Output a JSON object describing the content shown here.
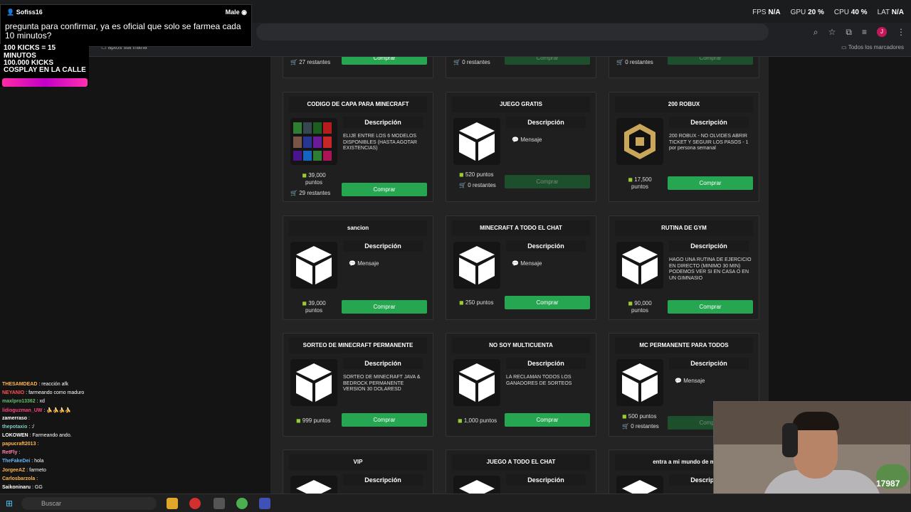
{
  "performance": {
    "fps_label": "FPS",
    "fps": "N/A",
    "gpu_label": "GPU",
    "gpu": "20 %",
    "cpu_label": "CPU",
    "cpu": "40 %",
    "lat_label": "LAT",
    "lat": "N/A"
  },
  "browser": {
    "bookmark_left": "aptos sta maria",
    "bookmark_right": "Todos los marcadores",
    "avatar": "J"
  },
  "stream_notice": {
    "user": "Sofiss16",
    "badge": "Male",
    "message": "pregunta para confirmar, ya es oficial que solo se farmea cada 10 minutos?"
  },
  "overlay": {
    "line1": "100 KICKS = 15 MINUTOS",
    "line2": "100.000 KICKS COSPLAY EN LA CALLE"
  },
  "chat": [
    {
      "user": "THESAMDEAD",
      "text": "reacción afk",
      "color": "#ffb74d"
    },
    {
      "user": "NEYANIO",
      "text": "farmeando como maduro",
      "color": "#ff5252"
    },
    {
      "user": "maxlpro13362",
      "text": "xd",
      "color": "#66bb6a"
    },
    {
      "user": "lidioguzman_UW",
      "text": "🍌🍌🍌🍌",
      "color": "#ff4081"
    },
    {
      "user": "zamerraso",
      "text": "",
      "color": "#ffffff"
    },
    {
      "user": "thepotaxio",
      "text": ":/",
      "color": "#80cbc4"
    },
    {
      "user": "LOKOWEN",
      "text": "Farmeando ando.",
      "color": "#ffffff"
    },
    {
      "user": "papucraft2013",
      "text": "",
      "color": "#ffb74d"
    },
    {
      "user": "RetFly",
      "text": "",
      "color": "#ff80ab"
    },
    {
      "user": "TheFakeDei",
      "text": "hola",
      "color": "#64b5f6"
    },
    {
      "user": "JorgeeAZ",
      "text": "farmeto",
      "color": "#ffb74d"
    },
    {
      "user": "Carlosbarzola",
      "text": "",
      "color": "#ffb74d"
    },
    {
      "user": "Saikoninaru",
      "text": "GG",
      "color": "#ffffff"
    }
  ],
  "common": {
    "buy": "Comprar",
    "desc": "Descripción",
    "msg": "Mensaje",
    "points": "puntos",
    "remaining_suffix": "restantes"
  },
  "top_row": [
    {
      "remaining": "27 restantes",
      "enabled": true
    },
    {
      "remaining": "0 restantes",
      "enabled": false
    },
    {
      "remaining": "0 restantes",
      "enabled": false
    }
  ],
  "cards": [
    {
      "title": "CODIGO DE CAPA PARA MINECRAFT",
      "desc": "ELIJE ENTRE LOS 6 MODELOS DISPONIBLES (HASTA AGOTAR EXISTENCIAS)",
      "points": "39,000",
      "remaining": "29 restantes",
      "enabled": true
    },
    {
      "title": "JUEGO GRATIS",
      "desc": "",
      "points": "520 puntos",
      "remaining": "0 restantes",
      "enabled": false
    },
    {
      "title": "200 ROBUX",
      "desc": "200 ROBUX - NO OLVIDES ABRIR TICKET Y SEGUIR LOS PASOS - 1 por persona semanal",
      "points": "17,500",
      "remaining": "",
      "enabled": true
    },
    {
      "title": "sancion",
      "desc": "",
      "points": "39,000",
      "remaining": "",
      "enabled": true
    },
    {
      "title": "MINECRAFT A TODO EL CHAT",
      "desc": "",
      "points": "250 puntos",
      "remaining": "",
      "enabled": true
    },
    {
      "title": "RUTINA DE GYM",
      "desc": "HAGO UNA RUTINA DE EJERCICIO EN DIRECTO (MINIMO 30 MIN) PODEMOS VER SI EN CASA O EN UN GIMNASIO",
      "points": "90,000",
      "remaining": "",
      "enabled": true
    },
    {
      "title": "SORTEO DE MINECRAFT PERMANENTE",
      "desc": "SORTEO DE MINECRAFT JAVA & BEDROCK PERMANENTE VERSION 30 DOLARESD",
      "points": "999 puntos",
      "remaining": "",
      "enabled": true
    },
    {
      "title": "NO SOY MULTICUENTA",
      "desc": "LA RECLAMAN TODOS LOS GANADORES DE SORTEOS",
      "points": "1,000 puntos",
      "remaining": "",
      "enabled": true
    },
    {
      "title": "MC PERMANENTE PARA TODOS",
      "desc": "",
      "points": "500 puntos",
      "remaining": "0 restantes",
      "enabled": false
    },
    {
      "title": "VIP",
      "desc": "",
      "points": "",
      "remaining": "",
      "enabled": true
    },
    {
      "title": "JUEGO A TODO EL CHAT",
      "desc": "",
      "points": "",
      "remaining": "",
      "enabled": true
    },
    {
      "title": "entra a mi mundo de m",
      "desc": "",
      "points": "",
      "remaining": "",
      "enabled": true
    }
  ],
  "taskbar": {
    "search": "Buscar"
  },
  "webcam": {
    "count": "17987"
  }
}
